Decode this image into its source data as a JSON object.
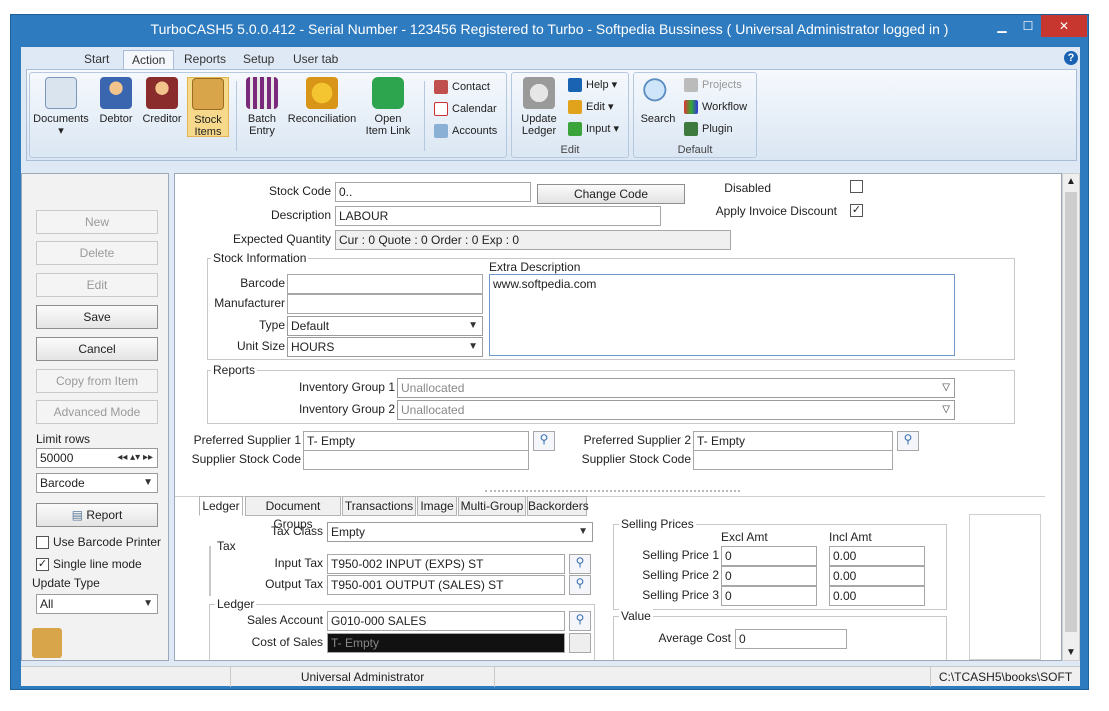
{
  "window": {
    "title": "TurboCASH5 5.0.0.412  - Serial Number - 123456 Registered to Turbo - Softpedia Bussiness ( Universal Administrator logged in )",
    "minimize": "▁",
    "maximize": "☐",
    "close": "✕"
  },
  "menu_tabs": [
    "Start",
    "Action",
    "Reports",
    "Setup",
    "User tab"
  ],
  "help_label": "?",
  "ribbon": {
    "main_buttons": [
      {
        "label": "Documents",
        "sub": "▾"
      },
      {
        "label": "Debtor"
      },
      {
        "label": "Creditor"
      },
      {
        "label": "Stock Items"
      },
      {
        "label": "Batch Entry"
      },
      {
        "label": "Reconciliation"
      },
      {
        "label": "Open Item Link"
      }
    ],
    "small_buttons": [
      "Contact",
      "Calendar",
      "Accounts"
    ],
    "edit_group": {
      "big": "Update Ledger",
      "items": [
        "Help ▾",
        "Edit ▾",
        "Input ▾"
      ],
      "label": "Edit"
    },
    "default_group": {
      "big": "Search",
      "items": [
        "Projects",
        "Workflow",
        "Plugin"
      ],
      "label": "Default"
    }
  },
  "left": {
    "buttons": [
      "New",
      "Delete",
      "Edit",
      "Save",
      "Cancel",
      "Copy from Item",
      "Advanced Mode"
    ],
    "limit_rows_label": "Limit rows",
    "limit_rows_value": "50000",
    "sort_select": "Barcode",
    "report_button": "Report",
    "use_barcode_printer": "Use Barcode Printer",
    "single_line_mode": "Single line mode",
    "update_type_label": "Update Type",
    "update_type_value": "All"
  },
  "form": {
    "stock_code_label": "Stock Code",
    "stock_code": "0..",
    "change_code": "Change Code",
    "description_label": "Description",
    "description": "LABOUR",
    "expected_label": "Expected Quantity",
    "expected": "Cur : 0 Quote : 0 Order : 0 Exp : 0",
    "disabled_label": "Disabled",
    "apply_discount_label": "Apply Invoice Discount",
    "apply_discount_check": "✓",
    "stock_info": "Stock Information",
    "barcode_label": "Barcode",
    "manufacturer_label": "Manufacturer",
    "type_label": "Type",
    "type_value": "Default",
    "unit_label": "Unit Size",
    "unit_value": "HOURS",
    "extra_desc_label": "Extra Description",
    "extra_desc": "www.softpedia.com",
    "reports_label": "Reports",
    "inv_group1_label": "Inventory Group 1",
    "inv_group1": "Unallocated",
    "inv_group2_label": "Inventory Group 2",
    "inv_group2": "Unallocated",
    "pref_sup1_label": "Preferred Supplier 1",
    "pref_sup1": "T- Empty",
    "pref_sup2_label": "Preferred Supplier 2",
    "pref_sup2": "T- Empty",
    "sup_code_label": "Supplier Stock Code"
  },
  "bottom_tabs": [
    "Ledger",
    "Document Groups",
    "Transactions",
    "Image",
    "Multi-Group",
    "Backorders"
  ],
  "ledger": {
    "tax_class_label": "Tax Class",
    "tax_class": "Empty",
    "tax_label": "Tax",
    "input_tax_label": "Input Tax",
    "input_tax": "T950-002 INPUT (EXPS) ST",
    "output_tax_label": "Output Tax",
    "output_tax": "T950-001 OUTPUT (SALES) ST",
    "ledger_label": "Ledger",
    "sales_label": "Sales Account",
    "sales": "G010-000 SALES",
    "cost_label": "Cost of Sales",
    "cost": "T- Empty",
    "selling_prices": "Selling Prices",
    "excl": "Excl Amt",
    "incl": "Incl Amt",
    "prices": [
      {
        "label": "Selling Price 1",
        "excl": "0",
        "incl": "0.00"
      },
      {
        "label": "Selling Price 2",
        "excl": "0",
        "incl": "0.00"
      },
      {
        "label": "Selling Price 3",
        "excl": "0",
        "incl": "0.00"
      }
    ],
    "value_label": "Value",
    "avg_cost_label": "Average Cost",
    "avg_cost": "0"
  },
  "status": {
    "user": "Universal Administrator",
    "path": "C:\\TCASH5\\books\\SOFT"
  }
}
